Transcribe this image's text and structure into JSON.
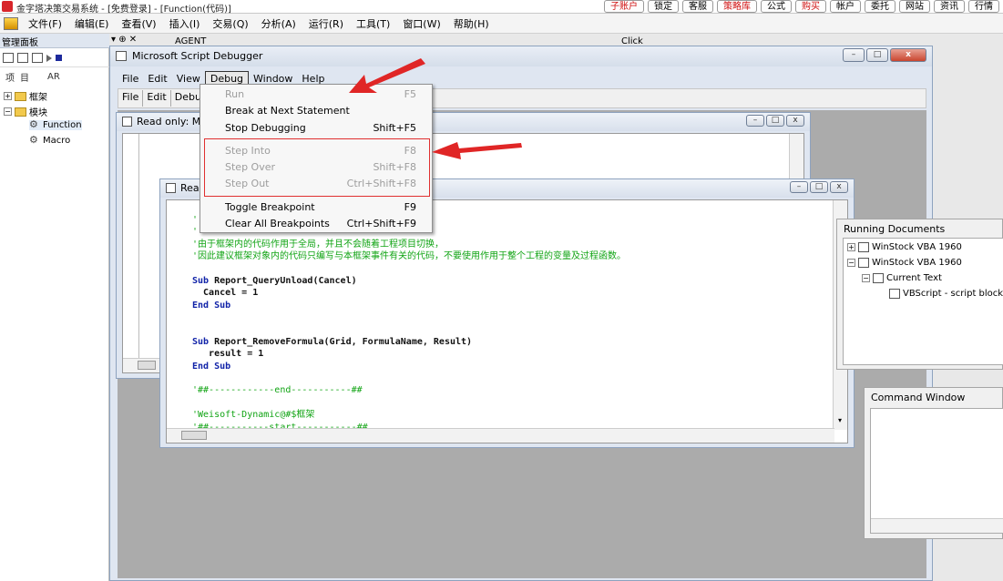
{
  "app": {
    "title": "金字塔决策交易系统 - [免费登录] - [Function(代码)]",
    "quick_buttons": [
      "子账户",
      "锁定",
      "客服",
      "策略库",
      "公式",
      "购买",
      "帐户",
      "委托",
      "网站",
      "资讯",
      "行情"
    ],
    "quick_red": [
      true,
      false,
      false,
      true,
      false,
      true,
      false,
      false,
      false,
      false,
      false
    ],
    "menu": [
      "文件(F)",
      "编辑(E)",
      "查看(V)",
      "插入(I)",
      "交易(Q)",
      "分析(A)",
      "运行(R)",
      "工具(T)",
      "窗口(W)",
      "帮助(H)"
    ]
  },
  "left_panel": {
    "title": "管理面板",
    "pin_icons": "▾ ⊕ ✕",
    "tabs": [
      "项",
      "目",
      "AR"
    ],
    "tree": [
      {
        "label": "框架",
        "expander": "+"
      },
      {
        "label": "模块",
        "expander": "−"
      },
      {
        "label": "Function"
      },
      {
        "label": "Macro"
      }
    ]
  },
  "background_labels": {
    "agent": "AGENT",
    "click": "Click"
  },
  "debugger": {
    "title": "Microsoft Script Debugger",
    "menu": [
      "File",
      "Edit",
      "View",
      "Debug",
      "Window",
      "Help"
    ],
    "toolbar": [
      "File",
      "Edit",
      "Debu"
    ],
    "window_buttons": {
      "minimize": "–",
      "maximize": "□",
      "close": "x"
    }
  },
  "back_window": {
    "title": "Read only: M"
  },
  "front_window": {
    "title": "Rea",
    "code": [
      {
        "text": "'",
        "kind": "comment"
      },
      {
        "text": "'",
        "kind": "comment"
      },
      {
        "text": "'由于框架内的代码作用于全局，并且不会随着工程项目切换，",
        "kind": "comment"
      },
      {
        "text": "'因此建议框架对象内的代码只编写与本框架事件有关的代码，不要使用作用于整个工程的变量及过程函数。",
        "kind": "comment"
      },
      {
        "text": "",
        "kind": "plain"
      },
      {
        "text": "Sub Report_QueryUnload(Cancel)",
        "kind": "sub"
      },
      {
        "text": "  Cancel = 1",
        "kind": "plain"
      },
      {
        "text": "End Sub",
        "kind": "keyword"
      },
      {
        "text": "",
        "kind": "plain"
      },
      {
        "text": "",
        "kind": "plain"
      },
      {
        "text": "Sub Report_RemoveFormula(Grid, FormulaName, Result)",
        "kind": "sub"
      },
      {
        "text": "   result = 1",
        "kind": "plain"
      },
      {
        "text": "End Sub",
        "kind": "keyword"
      },
      {
        "text": "",
        "kind": "plain"
      },
      {
        "text": "'##------------end-----------##",
        "kind": "comment"
      },
      {
        "text": "",
        "kind": "plain"
      },
      {
        "text": "'Weisoft-Dynamic@#$框架",
        "kind": "comment"
      },
      {
        "text": "'##-----------start-----------##",
        "kind": "comment"
      }
    ]
  },
  "debug_menu": {
    "items": [
      {
        "label": "Run",
        "shortcut": "F5",
        "disabled": true
      },
      {
        "label": "Break at Next Statement",
        "shortcut": "",
        "disabled": false
      },
      {
        "label": "Stop Debugging",
        "shortcut": "Shift+F5",
        "disabled": false
      },
      {
        "label": "Step Into",
        "shortcut": "F8",
        "disabled": true
      },
      {
        "label": "Step Over",
        "shortcut": "Shift+F8",
        "disabled": true
      },
      {
        "label": "Step Out",
        "shortcut": "Ctrl+Shift+F8",
        "disabled": true
      },
      {
        "label": "Toggle Breakpoint",
        "shortcut": "F9",
        "disabled": false
      },
      {
        "label": "Clear All Breakpoints",
        "shortcut": "Ctrl+Shift+F9",
        "disabled": false
      }
    ]
  },
  "running_documents": {
    "title": "Running Documents",
    "items": [
      {
        "label": "WinStock VBA 1960",
        "expander": "+"
      },
      {
        "label": "WinStock VBA 1960",
        "expander": "−"
      },
      {
        "label": "Current Text",
        "expander": "−"
      },
      {
        "label": "VBScript - script block",
        "expander": ""
      }
    ]
  },
  "command_window": {
    "title": "Command Window"
  },
  "colors": {
    "annotation_red": "#e02626",
    "comment_green": "#11a414",
    "keyword_blue": "#1022a8"
  }
}
